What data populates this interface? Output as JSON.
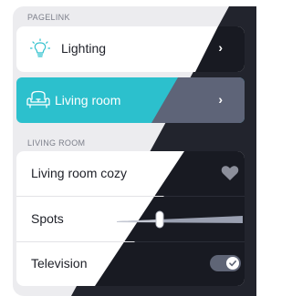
{
  "pagelink": {
    "section_title": "PAGELINK",
    "items": [
      {
        "label": "Lighting",
        "icon": "lightbulb-icon"
      },
      {
        "label": "Living room",
        "icon": "sofa-icon"
      }
    ]
  },
  "living_room": {
    "section_title": "LIVING ROOM",
    "scene": {
      "label": "Living room cozy",
      "icon": "heart-icon"
    },
    "spots": {
      "label": "Spots",
      "level": 0.22
    },
    "television": {
      "label": "Television",
      "state": "on"
    }
  },
  "colors": {
    "accent": "#2cc0cd",
    "dark_bg": "#22242d",
    "light_bg": "#ececef"
  }
}
